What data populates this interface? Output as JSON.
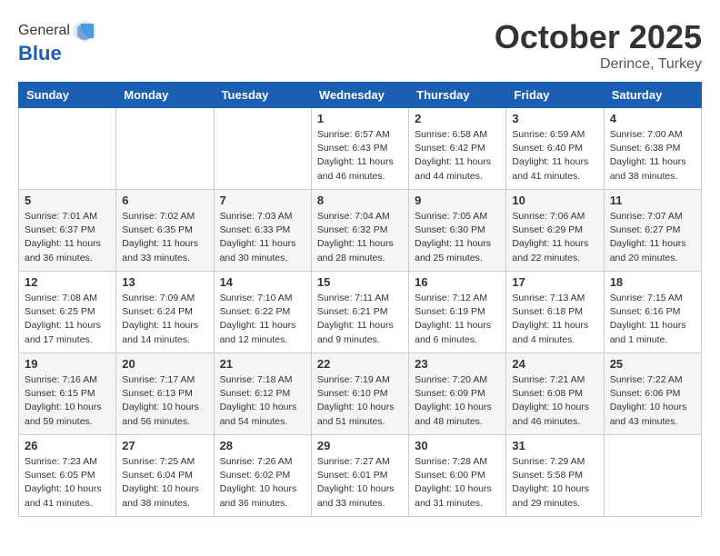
{
  "header": {
    "logo_general": "General",
    "logo_blue": "Blue",
    "month": "October 2025",
    "location": "Derince, Turkey"
  },
  "days_of_week": [
    "Sunday",
    "Monday",
    "Tuesday",
    "Wednesday",
    "Thursday",
    "Friday",
    "Saturday"
  ],
  "weeks": [
    [
      {
        "day": "",
        "info": ""
      },
      {
        "day": "",
        "info": ""
      },
      {
        "day": "",
        "info": ""
      },
      {
        "day": "1",
        "info": "Sunrise: 6:57 AM\nSunset: 6:43 PM\nDaylight: 11 hours\nand 46 minutes."
      },
      {
        "day": "2",
        "info": "Sunrise: 6:58 AM\nSunset: 6:42 PM\nDaylight: 11 hours\nand 44 minutes."
      },
      {
        "day": "3",
        "info": "Sunrise: 6:59 AM\nSunset: 6:40 PM\nDaylight: 11 hours\nand 41 minutes."
      },
      {
        "day": "4",
        "info": "Sunrise: 7:00 AM\nSunset: 6:38 PM\nDaylight: 11 hours\nand 38 minutes."
      }
    ],
    [
      {
        "day": "5",
        "info": "Sunrise: 7:01 AM\nSunset: 6:37 PM\nDaylight: 11 hours\nand 36 minutes."
      },
      {
        "day": "6",
        "info": "Sunrise: 7:02 AM\nSunset: 6:35 PM\nDaylight: 11 hours\nand 33 minutes."
      },
      {
        "day": "7",
        "info": "Sunrise: 7:03 AM\nSunset: 6:33 PM\nDaylight: 11 hours\nand 30 minutes."
      },
      {
        "day": "8",
        "info": "Sunrise: 7:04 AM\nSunset: 6:32 PM\nDaylight: 11 hours\nand 28 minutes."
      },
      {
        "day": "9",
        "info": "Sunrise: 7:05 AM\nSunset: 6:30 PM\nDaylight: 11 hours\nand 25 minutes."
      },
      {
        "day": "10",
        "info": "Sunrise: 7:06 AM\nSunset: 6:29 PM\nDaylight: 11 hours\nand 22 minutes."
      },
      {
        "day": "11",
        "info": "Sunrise: 7:07 AM\nSunset: 6:27 PM\nDaylight: 11 hours\nand 20 minutes."
      }
    ],
    [
      {
        "day": "12",
        "info": "Sunrise: 7:08 AM\nSunset: 6:25 PM\nDaylight: 11 hours\nand 17 minutes."
      },
      {
        "day": "13",
        "info": "Sunrise: 7:09 AM\nSunset: 6:24 PM\nDaylight: 11 hours\nand 14 minutes."
      },
      {
        "day": "14",
        "info": "Sunrise: 7:10 AM\nSunset: 6:22 PM\nDaylight: 11 hours\nand 12 minutes."
      },
      {
        "day": "15",
        "info": "Sunrise: 7:11 AM\nSunset: 6:21 PM\nDaylight: 11 hours\nand 9 minutes."
      },
      {
        "day": "16",
        "info": "Sunrise: 7:12 AM\nSunset: 6:19 PM\nDaylight: 11 hours\nand 6 minutes."
      },
      {
        "day": "17",
        "info": "Sunrise: 7:13 AM\nSunset: 6:18 PM\nDaylight: 11 hours\nand 4 minutes."
      },
      {
        "day": "18",
        "info": "Sunrise: 7:15 AM\nSunset: 6:16 PM\nDaylight: 11 hours\nand 1 minute."
      }
    ],
    [
      {
        "day": "19",
        "info": "Sunrise: 7:16 AM\nSunset: 6:15 PM\nDaylight: 10 hours\nand 59 minutes."
      },
      {
        "day": "20",
        "info": "Sunrise: 7:17 AM\nSunset: 6:13 PM\nDaylight: 10 hours\nand 56 minutes."
      },
      {
        "day": "21",
        "info": "Sunrise: 7:18 AM\nSunset: 6:12 PM\nDaylight: 10 hours\nand 54 minutes."
      },
      {
        "day": "22",
        "info": "Sunrise: 7:19 AM\nSunset: 6:10 PM\nDaylight: 10 hours\nand 51 minutes."
      },
      {
        "day": "23",
        "info": "Sunrise: 7:20 AM\nSunset: 6:09 PM\nDaylight: 10 hours\nand 48 minutes."
      },
      {
        "day": "24",
        "info": "Sunrise: 7:21 AM\nSunset: 6:08 PM\nDaylight: 10 hours\nand 46 minutes."
      },
      {
        "day": "25",
        "info": "Sunrise: 7:22 AM\nSunset: 6:06 PM\nDaylight: 10 hours\nand 43 minutes."
      }
    ],
    [
      {
        "day": "26",
        "info": "Sunrise: 7:23 AM\nSunset: 6:05 PM\nDaylight: 10 hours\nand 41 minutes."
      },
      {
        "day": "27",
        "info": "Sunrise: 7:25 AM\nSunset: 6:04 PM\nDaylight: 10 hours\nand 38 minutes."
      },
      {
        "day": "28",
        "info": "Sunrise: 7:26 AM\nSunset: 6:02 PM\nDaylight: 10 hours\nand 36 minutes."
      },
      {
        "day": "29",
        "info": "Sunrise: 7:27 AM\nSunset: 6:01 PM\nDaylight: 10 hours\nand 33 minutes."
      },
      {
        "day": "30",
        "info": "Sunrise: 7:28 AM\nSunset: 6:00 PM\nDaylight: 10 hours\nand 31 minutes."
      },
      {
        "day": "31",
        "info": "Sunrise: 7:29 AM\nSunset: 5:58 PM\nDaylight: 10 hours\nand 29 minutes."
      },
      {
        "day": "",
        "info": ""
      }
    ]
  ]
}
